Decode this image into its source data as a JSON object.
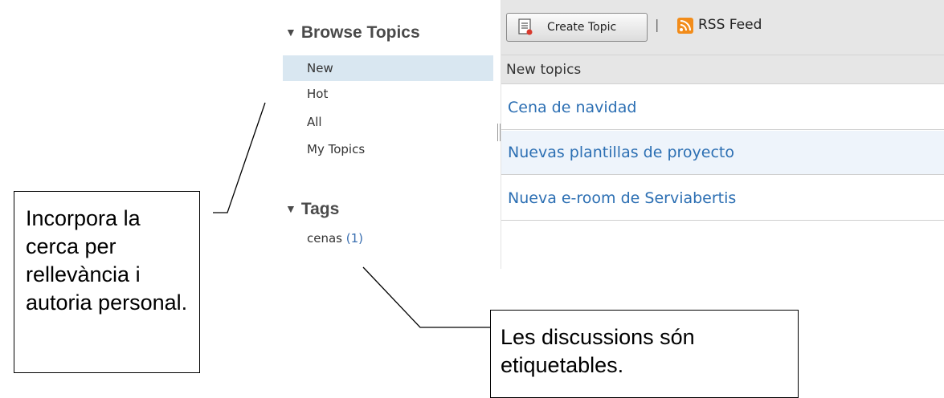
{
  "sidebar": {
    "browse_title": "Browse Topics",
    "items": [
      {
        "label": "New",
        "selected": true
      },
      {
        "label": "Hot"
      },
      {
        "label": "All"
      },
      {
        "label": "My Topics"
      }
    ],
    "tags_title": "Tags",
    "tags": [
      {
        "name": "cenas",
        "count": "(1)"
      }
    ]
  },
  "toolbar": {
    "create_label": "Create Topic",
    "separator": "|",
    "rss_label": "RSS Feed",
    "create_icon": "new-topic-icon",
    "rss_icon": "rss-icon"
  },
  "list": {
    "header": "New topics",
    "topics": [
      {
        "title": "Cena de navidad"
      },
      {
        "title": "Nuevas plantillas de proyecto"
      },
      {
        "title": "Nueva e-room de Serviabertis"
      }
    ]
  },
  "callouts": {
    "left": "Incorpora la cerca per rellevància i autoria personal.",
    "bottom": "Les discussions són etiquetables."
  },
  "colors": {
    "selected_bg": "#d9e7f1",
    "toolbar_bg": "#e6e6e6",
    "link": "#2c6fb3",
    "rss": "#f28c1a"
  }
}
